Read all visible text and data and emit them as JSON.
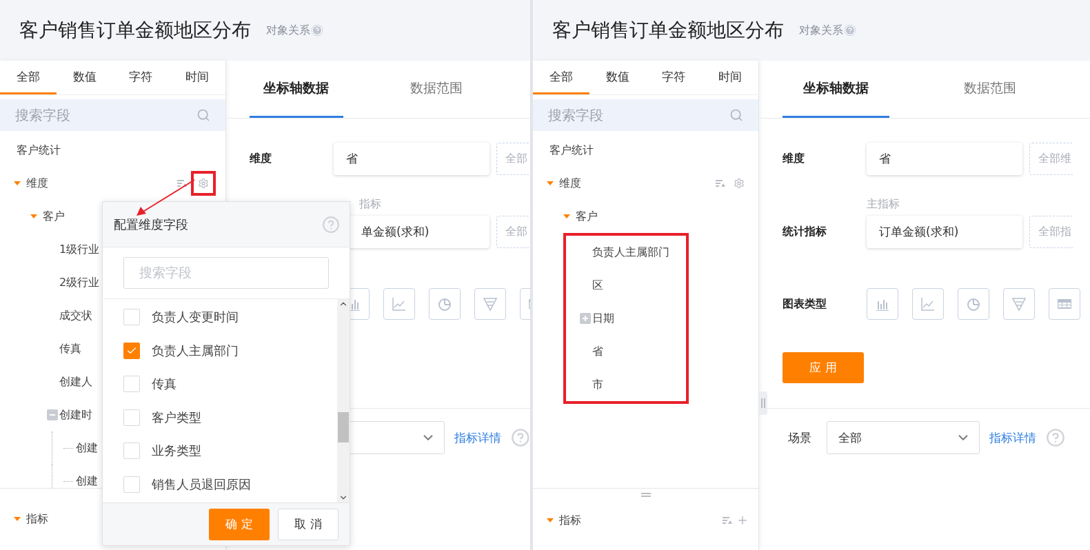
{
  "panels": [
    {
      "title": "客户销售订单金额地区分布",
      "relation_link": "对象关系",
      "field_tabs": [
        {
          "label": "全部",
          "selected": true
        },
        {
          "label": "数值",
          "selected": false
        },
        {
          "label": "字符",
          "selected": false
        },
        {
          "label": "时间",
          "selected": false
        }
      ],
      "search": {
        "placeholder": "搜索字段"
      },
      "tree": {
        "root": "客户统计",
        "groups": [
          {
            "label": "维度",
            "expanded": true,
            "gear_highlighted": true,
            "children": [
              {
                "label": "客户",
                "expanded": true,
                "highlighted": false,
                "children": [
                  {
                    "label": "1级行业"
                  },
                  {
                    "label": "2级行业"
                  },
                  {
                    "label": "成交状"
                  },
                  {
                    "label": "传真"
                  },
                  {
                    "label": "创建人"
                  },
                  {
                    "label": "创建时",
                    "expanded": true,
                    "children": [
                      {
                        "label": "创建"
                      },
                      {
                        "label": "创建"
                      }
                    ]
                  }
                ]
              }
            ]
          }
        ]
      },
      "metrics_group": {
        "label": "指标",
        "expanded": true
      },
      "main_tabs": [
        {
          "label": "坐标轴数据",
          "selected": true
        },
        {
          "label": "数据范围",
          "selected": false
        }
      ],
      "form": {
        "dimension": {
          "label": "维度",
          "value": "省",
          "extra": "全部"
        },
        "metric": {
          "caption": "指标",
          "value": "单金额(求和)",
          "extra": "全部"
        },
        "chart_types": [
          {
            "kind": "bar"
          },
          {
            "kind": "line"
          },
          {
            "kind": "pie"
          },
          {
            "kind": "funnel"
          },
          {
            "kind": "table"
          }
        ],
        "scene": {
          "detail_link": "指标详情"
        }
      },
      "popup": {
        "title": "配置维度字段",
        "search": {
          "placeholder": "搜索字段"
        },
        "options": [
          {
            "label": "负责人变更时间",
            "checked": false
          },
          {
            "label": "负责人主属部门",
            "checked": true
          },
          {
            "label": "传真",
            "checked": false
          },
          {
            "label": "客户类型",
            "checked": false
          },
          {
            "label": "业务类型",
            "checked": false
          },
          {
            "label": "销售人员退回原因",
            "checked": false
          }
        ],
        "buttons": [
          {
            "label": "确 定",
            "kind": "primary"
          },
          {
            "label": "取 消",
            "kind": "secondary"
          }
        ]
      }
    },
    {
      "title": "客户销售订单金额地区分布",
      "relation_link": "对象关系",
      "field_tabs": [
        {
          "label": "全部",
          "selected": true
        },
        {
          "label": "数值",
          "selected": false
        },
        {
          "label": "字符",
          "selected": false
        },
        {
          "label": "时间",
          "selected": false
        }
      ],
      "search": {
        "placeholder": "搜索字段"
      },
      "tree": {
        "root": "客户统计",
        "groups": [
          {
            "label": "维度",
            "expanded": true,
            "gear_highlighted": false,
            "children": [
              {
                "label": "客户",
                "expanded": true,
                "highlighted": true,
                "children": [
                  {
                    "label": "负责人主属部门"
                  },
                  {
                    "label": "区"
                  },
                  {
                    "label": "日期",
                    "expanded": false
                  },
                  {
                    "label": "省"
                  },
                  {
                    "label": "市"
                  }
                ]
              }
            ]
          }
        ]
      },
      "metrics_group": {
        "label": "指标",
        "expanded": true
      },
      "main_tabs": [
        {
          "label": "坐标轴数据",
          "selected": true
        },
        {
          "label": "数据范围",
          "selected": false
        }
      ],
      "form": {
        "dimension": {
          "label": "维度",
          "value": "省",
          "extra": "全部维"
        },
        "metric": {
          "caption": "主指标",
          "label": "统计指标",
          "value": "订单金额(求和)",
          "extra": "全部指"
        },
        "chart_type_label": "图表类型",
        "chart_types": [
          {
            "kind": "bar"
          },
          {
            "kind": "line"
          },
          {
            "kind": "pie"
          },
          {
            "kind": "funnel"
          },
          {
            "kind": "table"
          }
        ],
        "apply_button": "应 用",
        "scene": {
          "label": "场景",
          "value": "全部",
          "detail_link": "指标详情"
        }
      }
    }
  ]
}
